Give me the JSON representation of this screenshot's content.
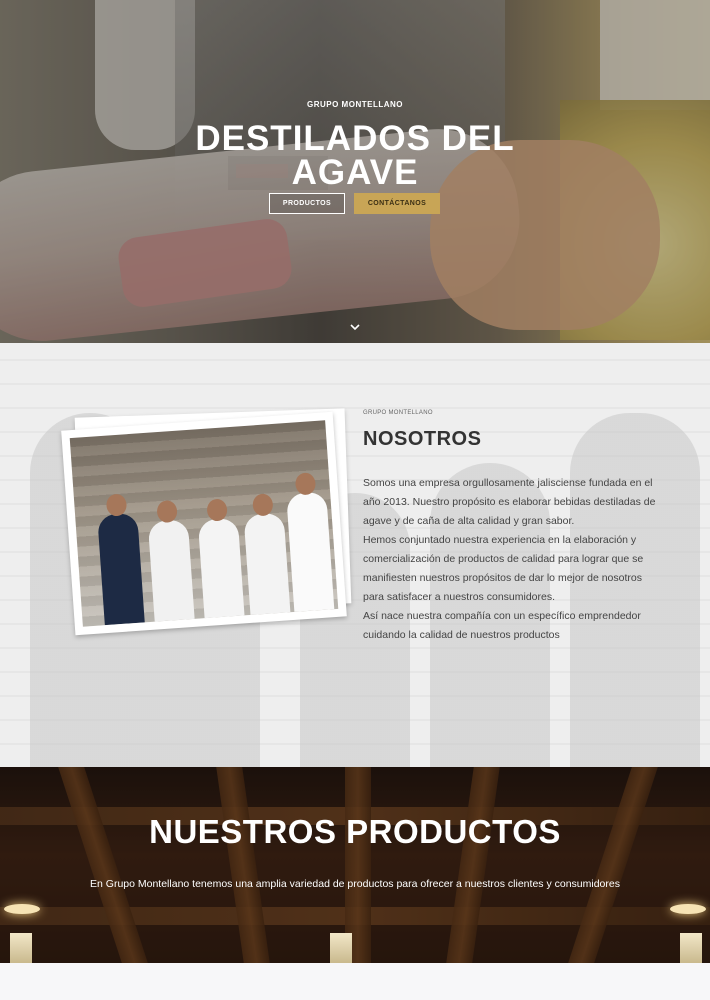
{
  "hero": {
    "eyebrow": "GRUPO MONTELLANO",
    "title_line1": "DESTILADOS DEL",
    "title_line2": "AGAVE",
    "btn_products": "PRODUCTOS",
    "btn_contact": "CONTÁCTANOS",
    "scroll_icon": "chevron-down-icon"
  },
  "about": {
    "eyebrow": "GRUPO MONTELLANO",
    "title": "NOSOTROS",
    "paragraphs": [
      "Somos una empresa orgullosamente jalisciense fundada en el año 2013. Nuestro propósito es elaborar bebidas destiladas de agave y de caña de alta calidad y gran sabor.",
      "Hemos conjuntado nuestra experiencia en la elaboración y comercialización de productos de calidad para lograr que se manifiesten nuestros propósitos de dar lo mejor de nosotros para satisfacer a nuestros consumidores.",
      "Así nace nuestra compañía con un específico emprendedor cuidando la calidad de nuestros productos"
    ]
  },
  "products": {
    "title": "NUESTROS PRODUCTOS",
    "subtitle": "En Grupo Montellano tenemos una amplia variedad de productos para ofrecer a nuestros clientes y consumidores"
  },
  "colors": {
    "accent_gold": "#c8a556",
    "text_dark": "#333333"
  }
}
